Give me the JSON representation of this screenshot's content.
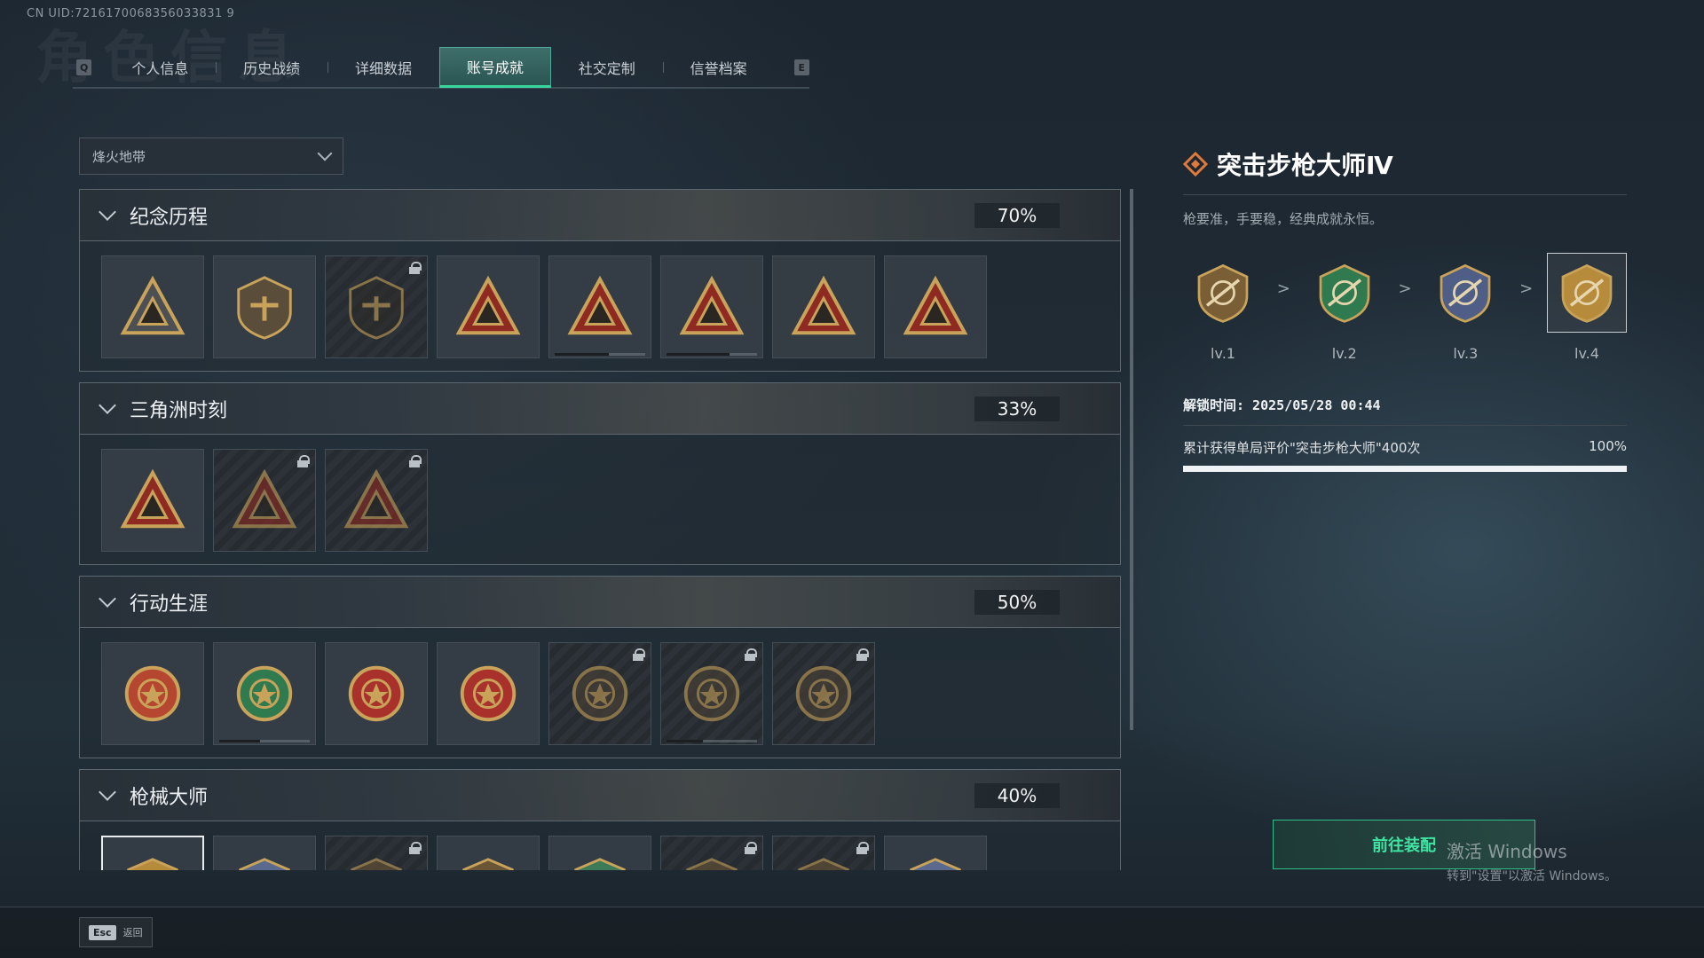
{
  "uid": "CN UID:7216170068356033831 9",
  "background_title": "角色信息",
  "tabs": {
    "left_key": "Q",
    "right_key": "E",
    "items": [
      {
        "label": "个人信息",
        "active": false
      },
      {
        "label": "历史战绩",
        "active": false
      },
      {
        "label": "详细数据",
        "active": false
      },
      {
        "label": "账号成就",
        "active": true
      },
      {
        "label": "社交定制",
        "active": false
      },
      {
        "label": "信誉档案",
        "active": false
      }
    ]
  },
  "mode_select": {
    "value": "烽火地带"
  },
  "sections": [
    {
      "title": "纪念历程",
      "percent": "70%",
      "badges": [
        {
          "icon": "triangle-emblem-icon",
          "locked": false,
          "progress": null
        },
        {
          "icon": "helicopter-emblem-icon",
          "locked": false,
          "progress": null
        },
        {
          "icon": "shield-emblem-icon",
          "locked": true,
          "progress": null
        },
        {
          "icon": "s4-emblem-icon",
          "locked": false,
          "progress": null
        },
        {
          "icon": "s6-emblem-icon",
          "locked": false,
          "progress": 0.6
        },
        {
          "icon": "s7-emblem-icon",
          "locked": false,
          "progress": 0.7
        },
        {
          "icon": "ship-emblem-icon",
          "locked": false,
          "progress": null
        },
        {
          "icon": "number-one-emblem-icon",
          "locked": false,
          "progress": null
        }
      ]
    },
    {
      "title": "三角洲时刻",
      "percent": "33%",
      "badges": [
        {
          "icon": "usb-emblem-icon",
          "locked": false,
          "progress": null
        },
        {
          "icon": "operator-emblem-icon",
          "locked": true,
          "progress": null
        },
        {
          "icon": "gem-emblem-icon",
          "locked": true,
          "progress": null
        }
      ]
    },
    {
      "title": "行动生涯",
      "percent": "50%",
      "badges": [
        {
          "icon": "star-medal-icon",
          "locked": false,
          "progress": null
        },
        {
          "icon": "green-shield-medal-icon",
          "locked": false,
          "progress": 0.45
        },
        {
          "icon": "red-stars-medal-icon",
          "locked": false,
          "progress": null
        },
        {
          "icon": "red-diamond-medal-icon",
          "locked": false,
          "progress": null
        },
        {
          "icon": "coin-medal-icon",
          "locked": true,
          "progress": null
        },
        {
          "icon": "skull-crosshair-medal-icon",
          "locked": true,
          "progress": 0.4
        },
        {
          "icon": "eye-medal-icon",
          "locked": true,
          "progress": null
        }
      ]
    },
    {
      "title": "枪械大师",
      "percent": "40%",
      "badges": [
        {
          "icon": "rifle-gold-badge-icon",
          "locked": false,
          "selected": true,
          "progress": null
        },
        {
          "icon": "rifle-blue-badge-icon",
          "locked": false,
          "progress": null
        },
        {
          "icon": "rifle-bronze-badge-icon",
          "locked": true,
          "progress": null
        },
        {
          "icon": "rifle-bronze-badge-icon",
          "locked": false,
          "progress": null
        },
        {
          "icon": "rifle-green-badge-icon",
          "locked": false,
          "progress": null
        },
        {
          "icon": "rifle-bronze-badge-icon",
          "locked": true,
          "progress": null
        },
        {
          "icon": "rifle-bronze-badge-icon",
          "locked": true,
          "progress": null
        },
        {
          "icon": "rifle-blue-badge-icon",
          "locked": false,
          "progress": null
        }
      ]
    }
  ],
  "detail": {
    "title": "突击步枪大师Ⅳ",
    "description": "枪要准，手要稳，经典成就永恒。",
    "levels": [
      {
        "label": "lv.1",
        "tier": "bronze",
        "current": false
      },
      {
        "label": "lv.2",
        "tier": "green",
        "current": false
      },
      {
        "label": "lv.3",
        "tier": "blue",
        "current": false
      },
      {
        "label": "lv.4",
        "tier": "gold",
        "current": true
      }
    ],
    "level_arrow": ">",
    "unlock_time": "解锁时间: 2025/05/28 00:44",
    "condition": "累计获得单局评价\"突击步枪大师\"400次",
    "condition_percent": "100%"
  },
  "equip_button": "前往装配",
  "watermark": {
    "line1": "激活 Windows",
    "line2": "转到\"设置\"以激活 Windows。"
  },
  "back": {
    "key": "Esc",
    "label": "返回"
  },
  "colors": {
    "accent_green": "#39d69d",
    "gold": "#c9a35a",
    "bronze": "#8a6a3a"
  }
}
